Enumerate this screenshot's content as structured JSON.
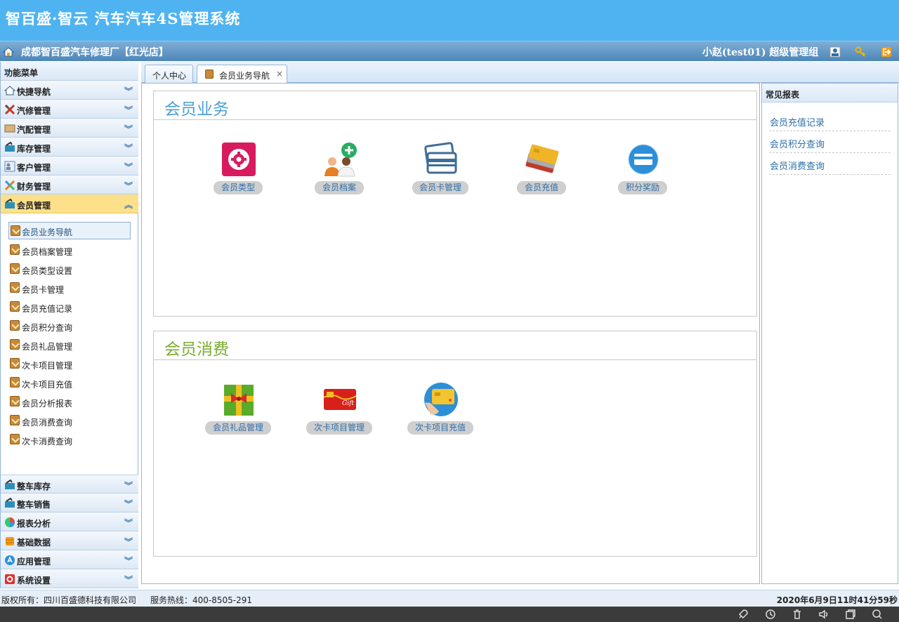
{
  "app": {
    "title": "智百盛·智云 汽车汽车4S管理系统"
  },
  "orgbar": {
    "org": "成都智百盛汽车修理厂【红光店】",
    "user": "小赵(test01) 超级管理组"
  },
  "menu": {
    "header": "功能菜单",
    "top_items": [
      {
        "label": "快捷导航",
        "icon": "home-icon"
      },
      {
        "label": "汽修管理",
        "icon": "tools-icon"
      },
      {
        "label": "汽配管理",
        "icon": "parts-icon"
      },
      {
        "label": "库存管理",
        "icon": "inventory-icon"
      },
      {
        "label": "客户管理",
        "icon": "customer-icon"
      },
      {
        "label": "财务管理",
        "icon": "finance-icon"
      },
      {
        "label": "会员管理",
        "icon": "member-icon"
      }
    ],
    "sub_items": [
      "会员业务导航",
      "会员档案管理",
      "会员类型设置",
      "会员卡管理",
      "会员充值记录",
      "会员积分查询",
      "会员礼品管理",
      "次卡项目管理",
      "次卡项目充值",
      "会员分析报表",
      "会员消费查询",
      "次卡消费查询"
    ],
    "bottom_items": [
      {
        "label": "整车库存",
        "icon": "car-stock-icon"
      },
      {
        "label": "整车销售",
        "icon": "car-sale-icon"
      },
      {
        "label": "报表分析",
        "icon": "pie-chart-icon"
      },
      {
        "label": "基础数据",
        "icon": "database-icon"
      },
      {
        "label": "应用管理",
        "icon": "app-icon"
      },
      {
        "label": "系统设置",
        "icon": "settings-icon"
      }
    ]
  },
  "tabs": [
    {
      "label": "个人中心"
    },
    {
      "label": "会员业务导航",
      "close": "×"
    }
  ],
  "sections": {
    "business": {
      "title": "会员业务",
      "title_color": "#4a9fd6",
      "tiles": [
        "会员类型",
        "会员档案",
        "会员卡管理",
        "会员充值",
        "积分奖励"
      ]
    },
    "consumption": {
      "title": "会员消费",
      "title_color": "#7aad2f",
      "tiles": [
        "会员礼品管理",
        "次卡项目管理",
        "次卡项目充值"
      ]
    }
  },
  "reports": {
    "title": "常见报表",
    "links": [
      "会员充值记录",
      "会员积分查询",
      "会员消费查询"
    ]
  },
  "footer": {
    "copyright": "版权所有：四川百盛德科技有限公司",
    "hotline": "服务热线：400-8505-291",
    "datetime": "2020年6月9日11时41分59秒"
  }
}
